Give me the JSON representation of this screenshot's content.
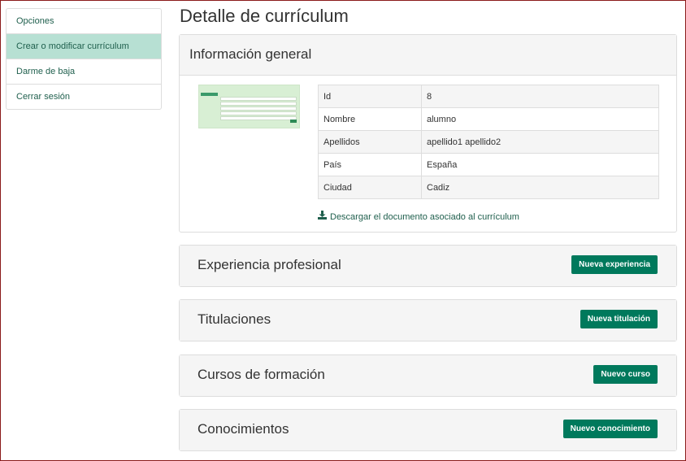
{
  "sidebar": {
    "items": [
      {
        "label": "Opciones"
      },
      {
        "label": "Crear o modificar currículum"
      },
      {
        "label": "Darme de baja"
      },
      {
        "label": "Cerrar sesión"
      }
    ]
  },
  "main": {
    "title": "Detalle de currículum",
    "info": {
      "title": "Información general",
      "rows": [
        {
          "key": "Id",
          "value": "8"
        },
        {
          "key": "Nombre",
          "value": "alumno"
        },
        {
          "key": "Apellidos",
          "value": "apellido1 apellido2"
        },
        {
          "key": "País",
          "value": "España"
        },
        {
          "key": "Ciudad",
          "value": "Cadiz"
        }
      ],
      "download_label": "Descargar el documento asociado al currículum"
    },
    "sections": [
      {
        "title": "Experiencia profesional",
        "button": "Nueva experiencia"
      },
      {
        "title": "Titulaciones",
        "button": "Nueva titulación"
      },
      {
        "title": "Cursos de formación",
        "button": "Nuevo curso"
      },
      {
        "title": "Conocimientos",
        "button": "Nuevo conocimiento"
      }
    ]
  },
  "colors": {
    "accent": "#00795c",
    "active_item": "#b7e0d3",
    "link": "#1f5f4d"
  },
  "icons": {
    "download": "download-icon"
  }
}
